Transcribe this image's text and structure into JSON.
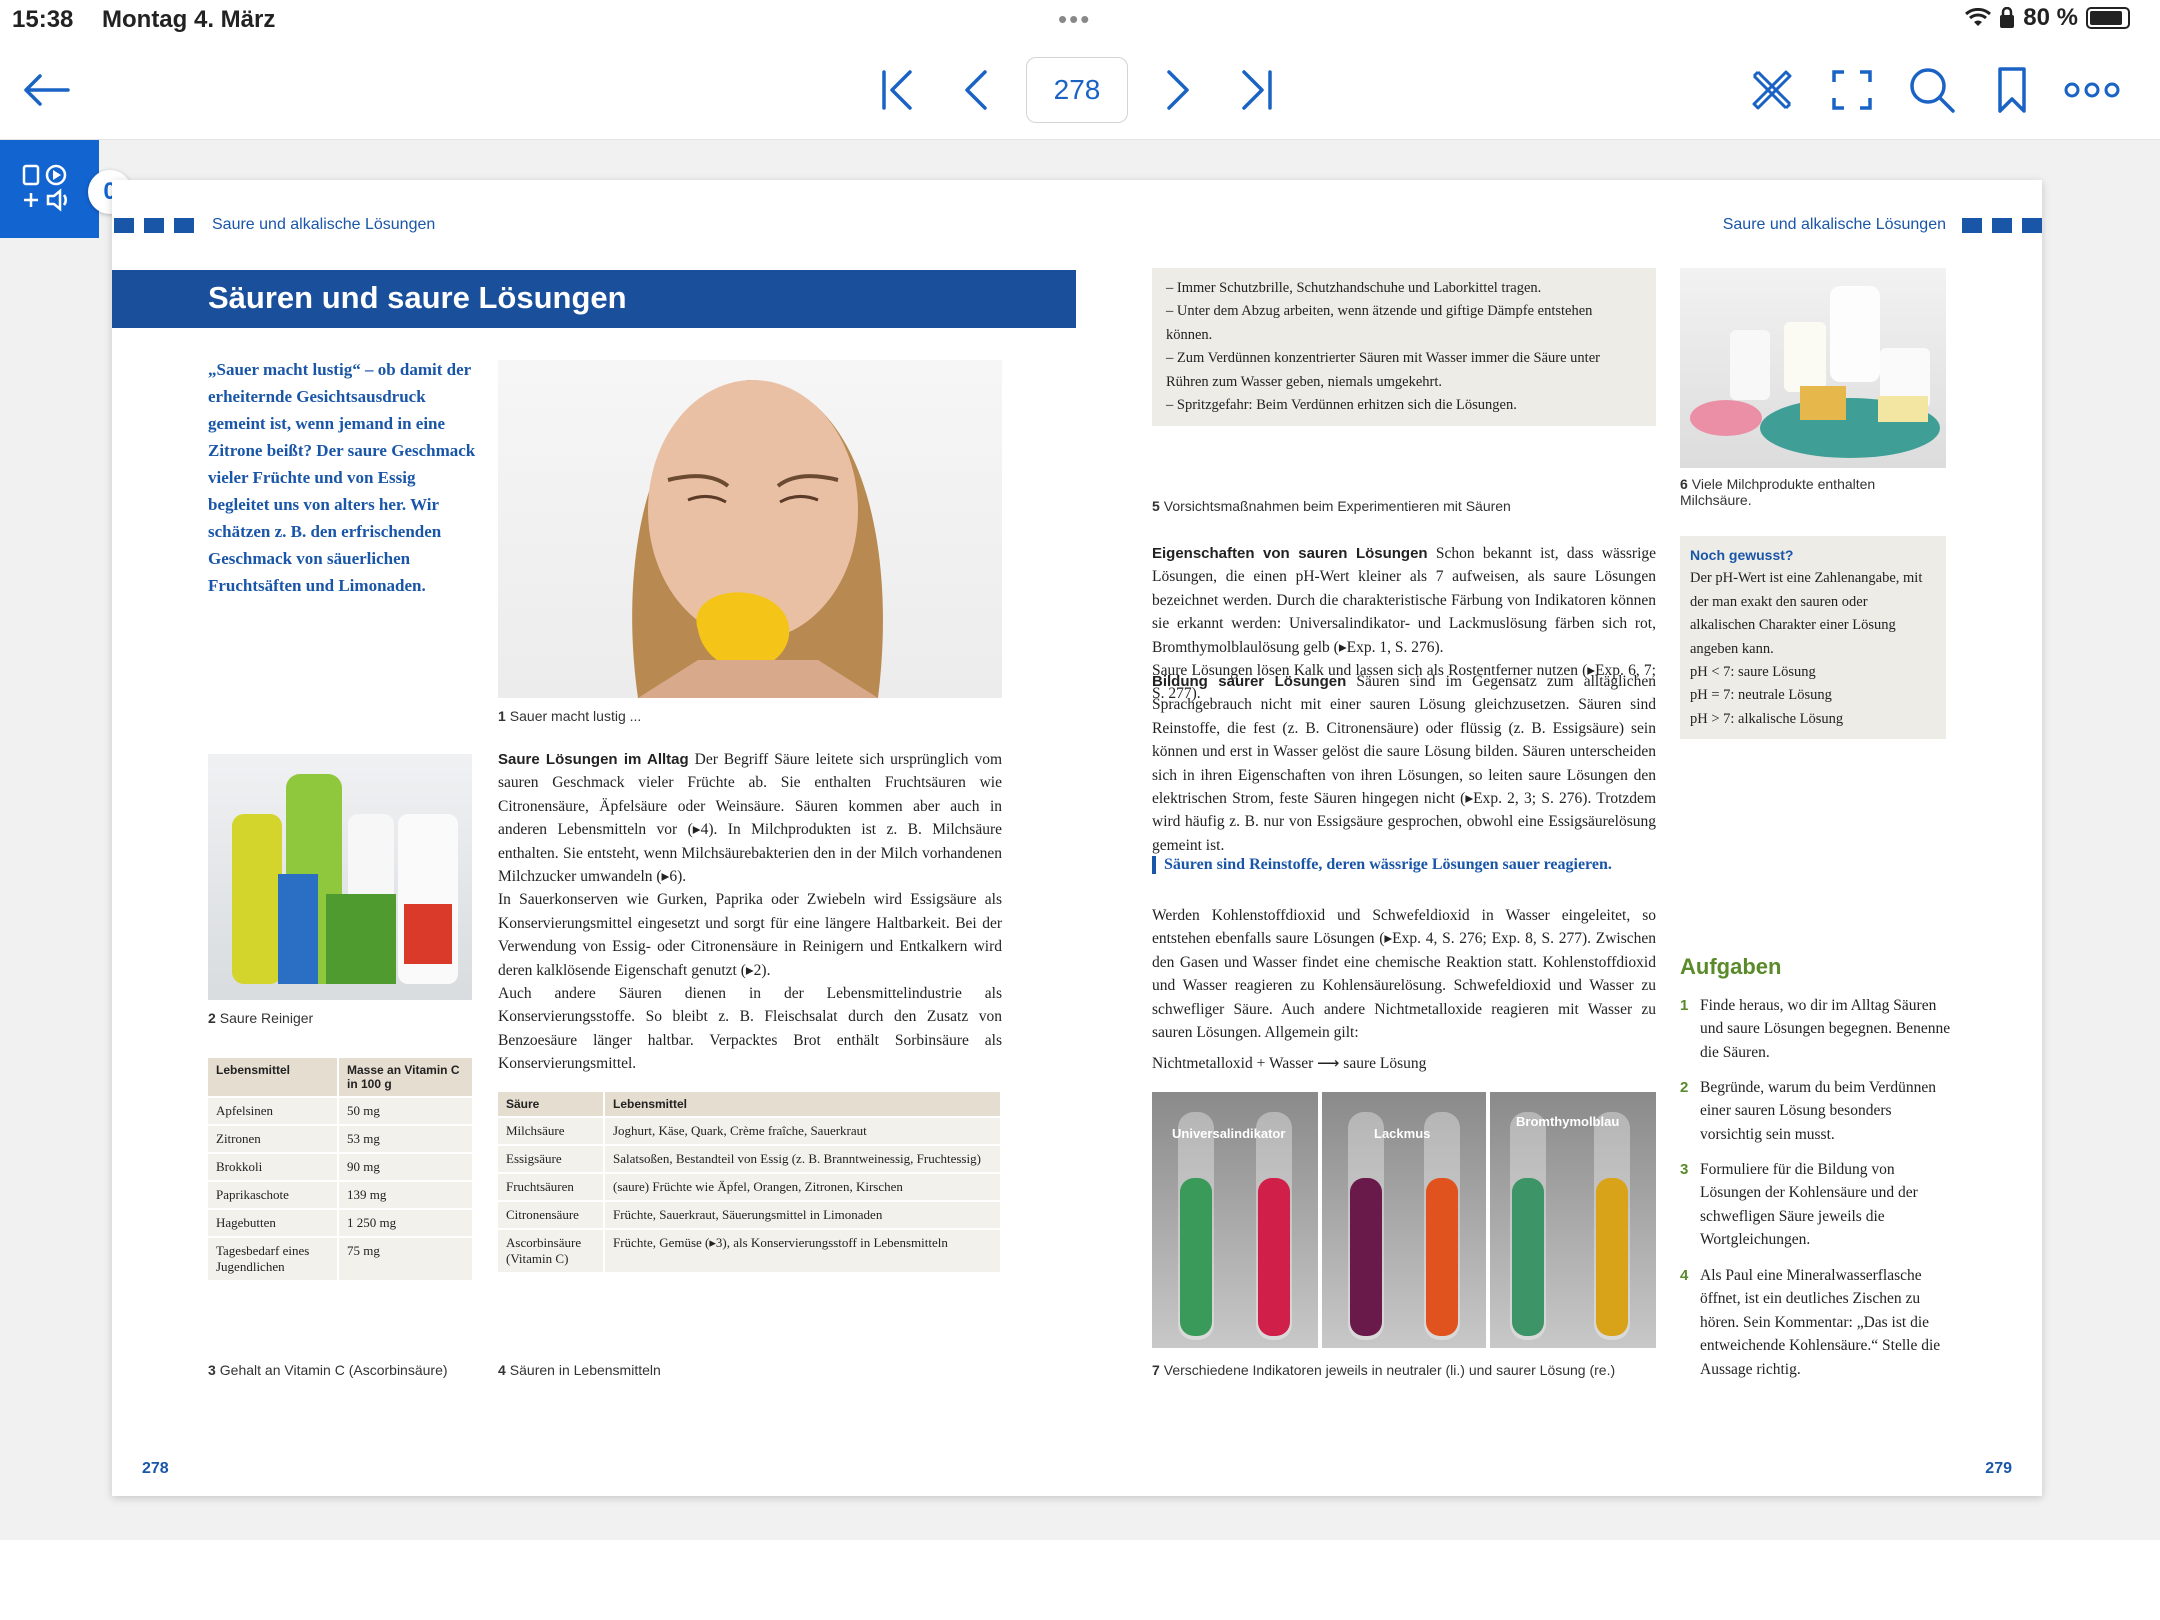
{
  "status": {
    "time": "15:38",
    "date": "Montag 4. März",
    "battery": "80 %"
  },
  "toolbar": {
    "page_number": "278"
  },
  "sidebar": {
    "count": "0"
  },
  "book": {
    "running_head": "Saure und alkalische Lösungen",
    "title": "Säuren und saure Lösungen",
    "intro": "„Sauer macht lustig“ – ob damit der erheiternde Gesichtsausdruck gemeint ist, wenn jemand in eine Zitrone beißt? Der saure Geschmack vieler Früchte und von Essig begleitet uns von alters her. Wir schätzen z. B. den erfrischenden Geschmack von säuerlichen Fruchtsäften und Limonaden.",
    "captions": {
      "c1_num": "1",
      "c1": "Sauer macht lustig ...",
      "c2_num": "2",
      "c2": "Saure Reiniger",
      "c3_num": "3",
      "c3": "Gehalt an Vitamin C (Ascorbinsäure)",
      "c4_num": "4",
      "c4": "Säuren in Lebensmitteln",
      "c5_num": "5",
      "c5": "Vorsichtsmaßnahmen beim Experimentieren mit Säuren",
      "c6_num": "6",
      "c6": "Viele Milchprodukte enthalten Milchsäure.",
      "c7_num": "7",
      "c7": "Verschiedene Indikatoren jeweils in neutraler (li.) und saurer Lösung (re.)"
    },
    "saure_head": "Saure Lösungen im Alltag",
    "saure_body": "Der Begriff Säure leitete sich ursprünglich vom sauren Geschmack vieler Früchte ab. Sie enthalten Fruchtsäuren wie Citronensäure, Äpfelsäure oder Weinsäure. Säuren kommen aber auch in anderen Lebensmitteln vor (▸4). In Milchprodukten ist z. B. Milchsäure enthalten. Sie entsteht, wenn Milchsäurebakterien den in der Milch vorhandenen Milchzucker umwandeln (▸6).",
    "saure_body2": "In Sauerkonserven wie Gurken, Paprika oder Zwiebeln wird Essigsäure als Konservierungsmittel eingesetzt und sorgt für eine längere Haltbarkeit. Bei der Verwendung von Essig- oder Citronensäure in Reinigern und Entkalkern wird deren kalklösende Eigenschaft genutzt (▸2).",
    "saure_body3": "Auch andere Säuren dienen in der Lebensmittelindustrie als Konservierungsstoffe. So bleibt z. B. Fleischsalat durch den Zusatz von Benzoesäure länger haltbar. Verpacktes Brot enthält Sorbinsäure als Konservierungsmittel.",
    "vitc_table": {
      "headers": [
        "Lebensmittel",
        "Masse an Vitamin C in 100 g"
      ],
      "rows": [
        [
          "Apfelsinen",
          "50 mg"
        ],
        [
          "Zitronen",
          "53 mg"
        ],
        [
          "Brokkoli",
          "90 mg"
        ],
        [
          "Paprikaschote",
          "139 mg"
        ],
        [
          "Hagebutten",
          "1 250 mg"
        ],
        [
          "Tagesbedarf eines Jugendlichen",
          "75 mg"
        ]
      ]
    },
    "acid_table": {
      "headers": [
        "Säure",
        "Lebensmittel"
      ],
      "rows": [
        [
          "Milchsäure",
          "Joghurt, Käse, Quark, Crème fraîche, Sauerkraut"
        ],
        [
          "Essigsäure",
          "Salatsoßen, Bestandteil von Essig (z. B. Branntweinessig, Fruchtessig)"
        ],
        [
          "Fruchtsäuren",
          "(saure) Früchte wie Äpfel, Orangen, Zitronen, Kirschen"
        ],
        [
          "Citronensäure",
          "Früchte, Sauerkraut, Säuerungsmittel in Limonaden"
        ],
        [
          "Ascorbinsäure (Vitamin C)",
          "Früchte, Gemüse (▸3), als Konservierungsstoff in Lebensmitteln"
        ]
      ]
    },
    "safety": [
      "Immer Schutzbrille, Schutzhandschuhe und Laborkittel tragen.",
      "Unter dem Abzug arbeiten, wenn ätzende und giftige Dämpfe entstehen können.",
      "Zum Verdünnen konzentrierter Säuren mit Wasser immer die Säure unter Rühren zum Wasser geben, niemals umgekehrt.",
      "Spritzgefahr: Beim Verdünnen erhitzen sich die Lösungen."
    ],
    "eig_head": "Eigenschaften von sauren Lösungen",
    "eig_body": "Schon bekannt ist, dass wässrige Lösungen, die einen pH-Wert kleiner als 7 aufweisen, als saure Lösungen bezeichnet werden. Durch die charakteristische Färbung von Indikatoren können sie erkannt werden: Universalindikator- und Lackmuslösung färben sich rot, Bromthymolblaulösung gelb (▸Exp. 1, S. 276).",
    "eig_body2": "Saure Lösungen lösen Kalk und lassen sich als Rostentferner nutzen (▸Exp. 6, 7; S. 277).",
    "bild_head": "Bildung saurer Lösungen",
    "bild_body": "Säuren sind im Gegensatz zum alltäglichen Sprachgebrauch nicht mit einer sauren Lösung gleichzusetzen. Säuren sind Reinstoffe, die fest (z. B. Citronensäure) oder flüssig (z. B. Essigsäure) sein können und erst in Wasser gelöst die saure Lösung bilden. Säuren unterscheiden sich in ihren Eigenschaften von ihren Lösungen, so leiten saure Lösungen den elektrischen Strom, feste Säuren hingegen nicht (▸Exp. 2, 3; S. 276). Trotzdem wird häufig z. B. nur von Essigsäure gesprochen, obwohl eine Essigsäurelösung gemeint ist.",
    "keyline": "Säuren sind Reinstoffe, deren wässrige Lösungen sauer reagieren.",
    "gas_body": "Werden Kohlenstoffdioxid und Schwefeldioxid in Wasser eingeleitet, so entstehen ebenfalls saure Lösungen (▸Exp. 4, S. 276; Exp. 8, S. 277). Zwischen den Gasen und Wasser findet eine chemische Reaktion statt. Kohlenstoffdioxid und Wasser reagieren zu Kohlensäurelösung. Schwefeldioxid und Wasser zu schwefliger Säure. Auch andere Nichtmetalloxide reagieren mit Wasser zu sauren Lösungen. Allgemein gilt:",
    "equation": "Nichtmetalloxid + Wasser ⟶ saure Lösung",
    "indicators": [
      "Universalindikator",
      "Lackmus",
      "Bromthymolblau"
    ],
    "notice": {
      "head": "Noch gewusst?",
      "body": "Der pH-Wert ist eine Zahlenangabe, mit der man exakt den sauren oder alkalischen Charakter einer Lösung angeben kann.",
      "l1": "pH < 7: saure Lösung",
      "l2": "pH = 7: neutrale Lösung",
      "l3": "pH > 7: alkalische Lösung"
    },
    "tasks_head": "Aufgaben",
    "tasks": [
      {
        "n": "1",
        "t": "Finde heraus, wo dir im Alltag Säuren und saure Lösungen begegnen. Benenne die Säuren."
      },
      {
        "n": "2",
        "t": "Begründe, warum du beim Verdünnen einer sauren Lösung besonders vorsichtig sein musst."
      },
      {
        "n": "3",
        "t": "Formuliere für die Bildung von Lösungen der Kohlensäure und der schwefligen Säure jeweils die Wortgleichungen."
      },
      {
        "n": "4",
        "t": "Als Paul eine Mineralwasserflasche öffnet, ist ein deutliches Zischen zu hören. Sein Kommentar: „Das ist die entweichende Kohlensäure.“ Stelle die Aussage richtig."
      }
    ],
    "page_left": "278",
    "page_right": "279"
  }
}
